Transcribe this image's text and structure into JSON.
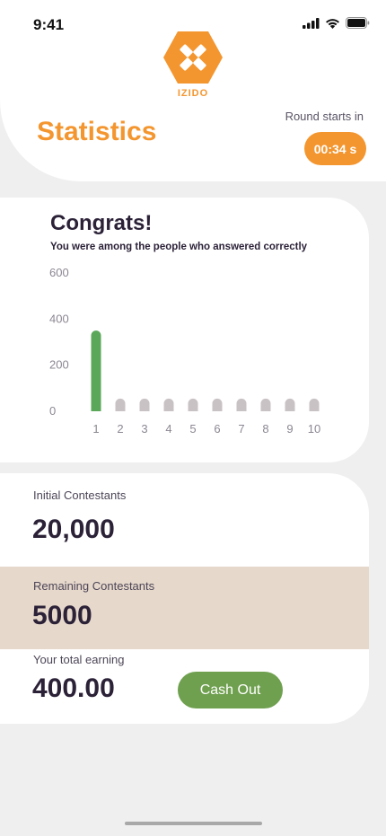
{
  "status_bar": {
    "time": "9:41"
  },
  "header": {
    "logo_text": "IZIDO",
    "title": "Statistics",
    "round_label": "Round starts in",
    "timer": "00:34 s"
  },
  "results": {
    "heading": "Congrats!",
    "subheading": "You were among the people who answered correctly"
  },
  "chart_data": {
    "type": "bar",
    "categories": [
      "1",
      "2",
      "3",
      "4",
      "5",
      "6",
      "7",
      "8",
      "9",
      "10"
    ],
    "values": [
      350,
      55,
      55,
      55,
      55,
      55,
      55,
      55,
      55,
      55
    ],
    "ylim": [
      0,
      600
    ],
    "yticks": [
      "0",
      "200",
      "400",
      "600"
    ],
    "highlight_index": 0,
    "colors": {
      "highlight": "#5aa75a",
      "default": "#c9c2c4"
    },
    "grid": false
  },
  "stats": {
    "initial_label": "Initial Contestants",
    "initial_value": "20,000",
    "remaining_label": "Remaining Contestants",
    "remaining_value": "5000",
    "earning_label": "Your total earning",
    "earning_value": "400.00",
    "cashout_label": "Cash Out"
  },
  "colors": {
    "accent": "#f4962f",
    "cashout": "#6fa04f",
    "band": "#e6d8cb",
    "text_dark": "#2c2238"
  }
}
